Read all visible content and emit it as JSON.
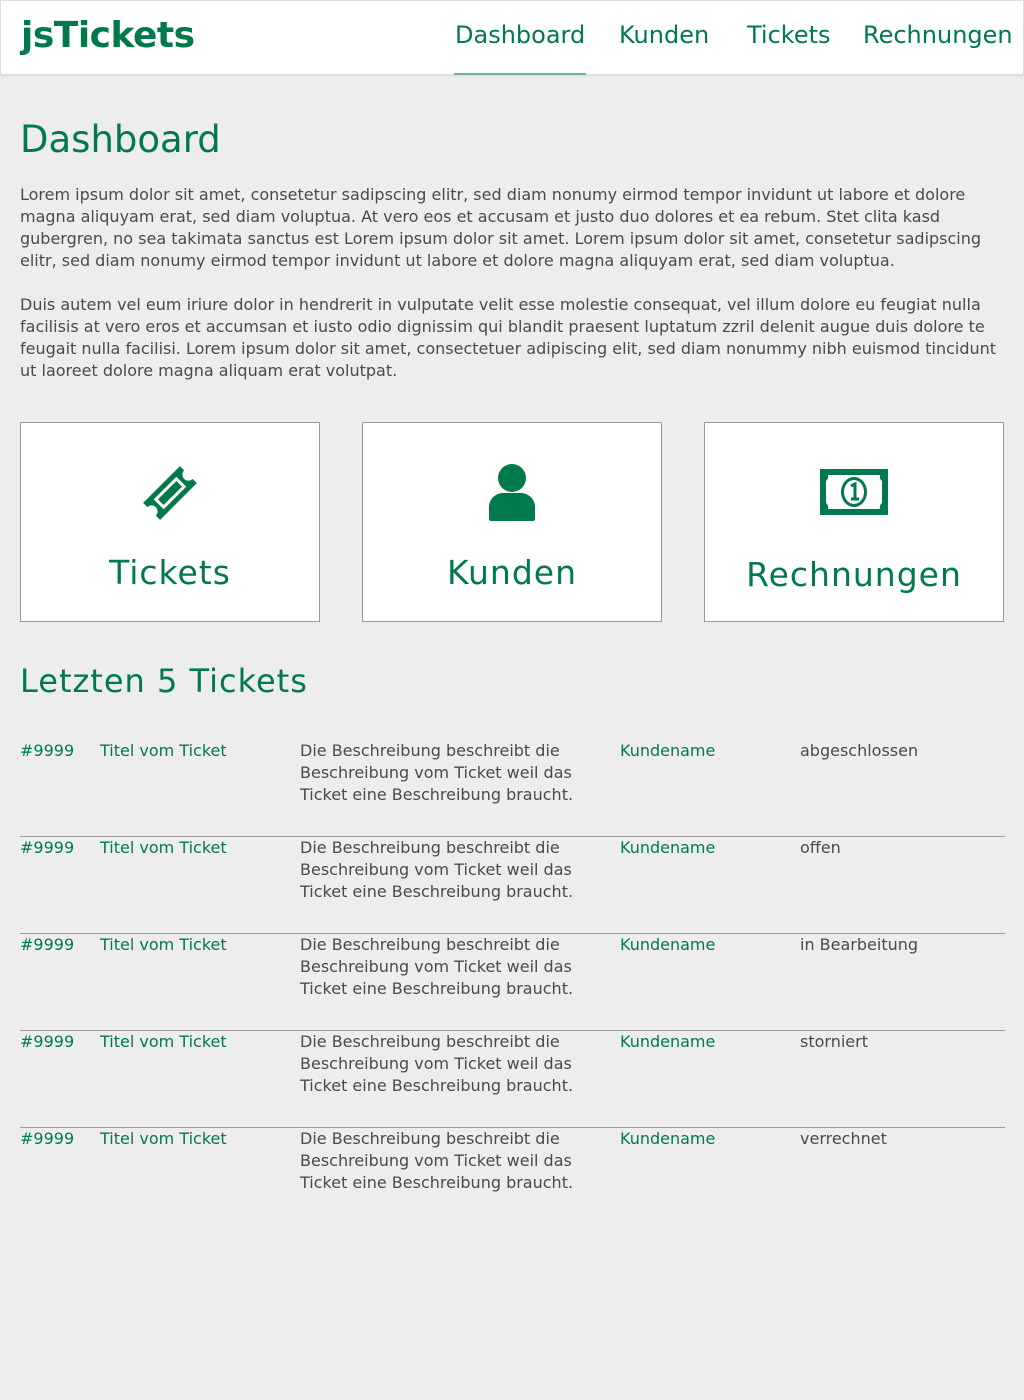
{
  "app": {
    "logo": "jsTickets"
  },
  "nav": {
    "items": [
      {
        "label": "Dashboard",
        "active": true
      },
      {
        "label": "Kunden",
        "active": false
      },
      {
        "label": "Tickets",
        "active": false
      },
      {
        "label": "Rechnungen",
        "active": false
      }
    ]
  },
  "page": {
    "title": "Dashboard",
    "paragraphs": [
      "Lorem ipsum dolor sit amet, consetetur sadipscing elitr, sed diam nonumy eirmod tempor invidunt ut labore et dolore magna aliquyam erat, sed diam voluptua. At vero eos et accusam et justo duo dolores et ea rebum. Stet clita kasd gubergren, no sea takimata sanctus est Lorem ipsum dolor sit amet. Lorem ipsum dolor sit amet, consetetur sadipscing elitr, sed diam nonumy eirmod tempor invidunt ut labore et dolore magna aliquyam erat, sed diam voluptua.",
      "Duis autem vel eum iriure dolor in hendrerit in vulputate velit esse molestie consequat, vel illum dolore eu feugiat nulla facilisis at vero eros et accumsan et iusto odio dignissim qui blandit praesent luptatum zzril delenit augue duis dolore te feugait nulla facilisi. Lorem ipsum dolor sit amet, consectetuer adipiscing elit, sed diam nonummy nibh euismod tincidunt ut laoreet dolore magna aliquam erat volutpat."
    ]
  },
  "cards": [
    {
      "label": "Tickets",
      "icon": "ticket-icon"
    },
    {
      "label": "Kunden",
      "icon": "user-icon"
    },
    {
      "label": "Rechnungen",
      "icon": "money-bill-icon"
    }
  ],
  "recent": {
    "title": "Letzten 5 Tickets",
    "rows": [
      {
        "id": "#9999",
        "title": "Titel vom Ticket",
        "desc": "Die Beschreibung beschreibt die Beschreibung vom Ticket weil das Ticket eine Beschreibung braucht.",
        "customer": "Kundename",
        "status": "abgeschlossen"
      },
      {
        "id": "#9999",
        "title": "Titel vom Ticket",
        "desc": "Die Beschreibung beschreibt die Beschreibung vom Ticket weil das Ticket eine Beschreibung braucht.",
        "customer": "Kundename",
        "status": "offen"
      },
      {
        "id": "#9999",
        "title": "Titel vom Ticket",
        "desc": "Die Beschreibung beschreibt die Beschreibung vom Ticket weil das Ticket eine Beschreibung braucht.",
        "customer": "Kundename",
        "status": "in Bearbeitung"
      },
      {
        "id": "#9999",
        "title": "Titel vom Ticket",
        "desc": "Die Beschreibung beschreibt die Beschreibung vom Ticket weil das Ticket eine Beschreibung braucht.",
        "customer": "Kundename",
        "status": "storniert"
      },
      {
        "id": "#9999",
        "title": "Titel vom Ticket",
        "desc": "Die Beschreibung beschreibt die Beschreibung vom Ticket weil das Ticket eine Beschreibung braucht.",
        "customer": "Kundename",
        "status": "verrechnet"
      }
    ]
  },
  "colors": {
    "brand": "#007a4a",
    "text": "#4a4a4a",
    "background": "#ededed"
  }
}
